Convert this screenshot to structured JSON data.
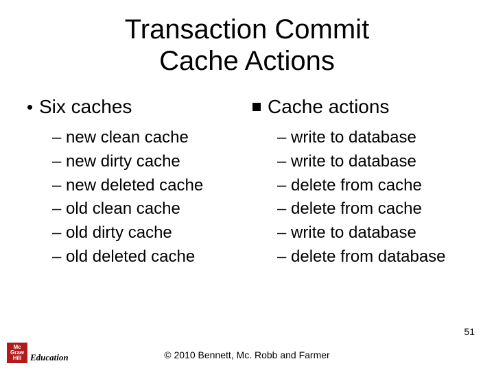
{
  "title_line1": "Transaction Commit",
  "title_line2": "Cache Actions",
  "left": {
    "heading": "Six caches",
    "items": [
      "new clean cache",
      "new dirty cache",
      "new deleted cache",
      "old clean cache",
      "old dirty cache",
      "old deleted cache"
    ]
  },
  "right": {
    "heading": "Cache actions",
    "items": [
      "write to database",
      "write to database",
      "delete from cache",
      "delete from cache",
      "write to database",
      "delete from database"
    ]
  },
  "footer": "© 2010 Bennett, Mc. Robb and Farmer",
  "page": "51",
  "logo": {
    "box_line1": "Mc",
    "box_line2": "Graw",
    "box_line3": "Hill",
    "text": "Education"
  }
}
